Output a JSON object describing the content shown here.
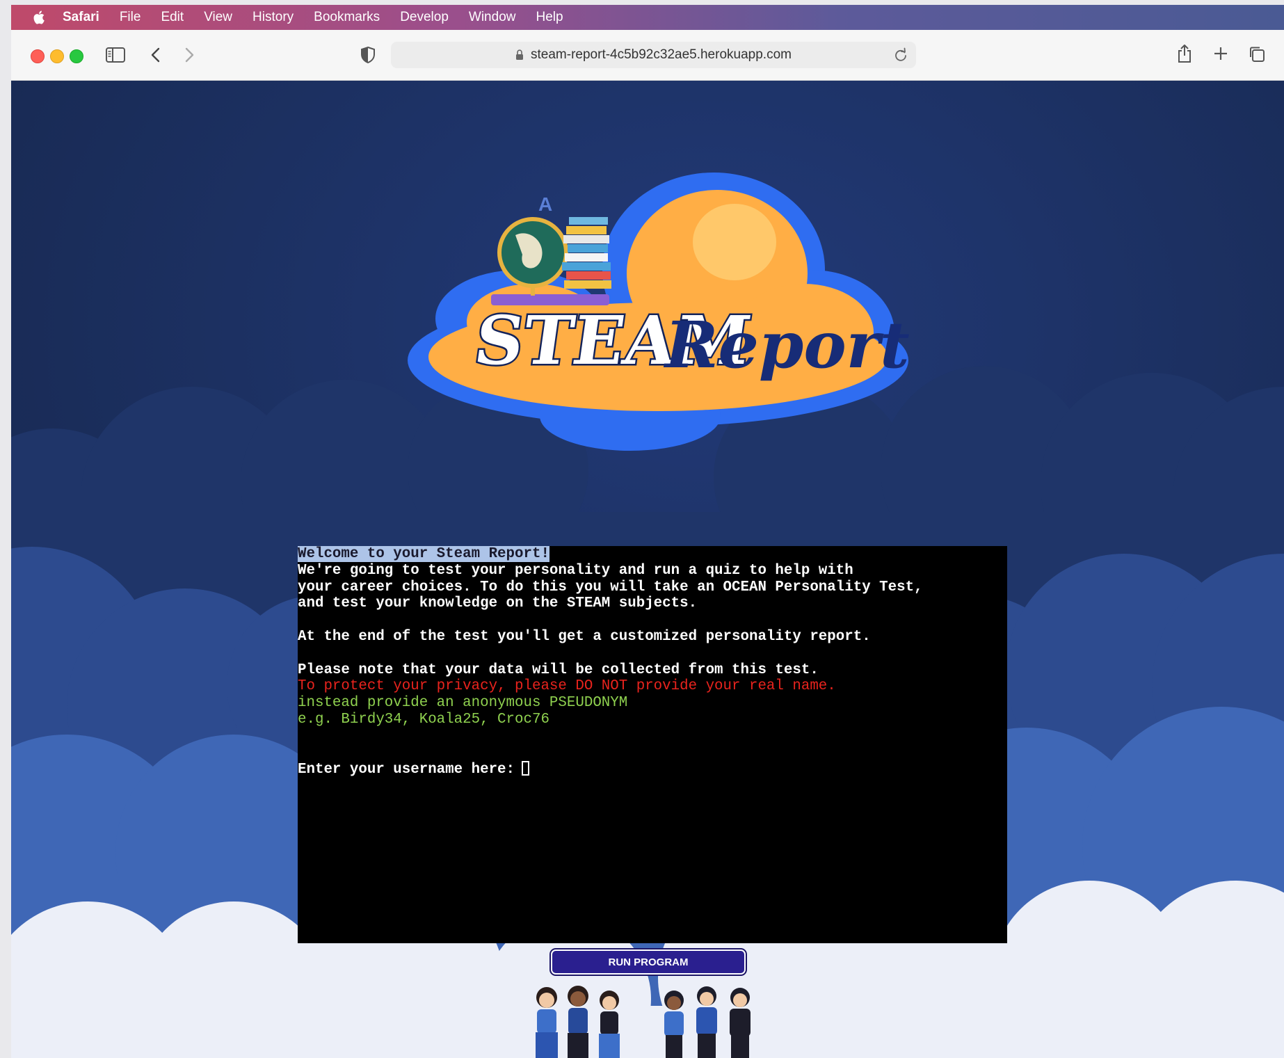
{
  "menubar": {
    "app_name": "Safari",
    "items": [
      "File",
      "Edit",
      "View",
      "History",
      "Bookmarks",
      "Develop",
      "Window",
      "Help"
    ]
  },
  "browser": {
    "url": "steam-report-4c5b92c32ae5.herokuapp.com"
  },
  "logo": {
    "word1": "STEAM",
    "word2": "Report"
  },
  "terminal": {
    "title_line": "Welcome to your Steam Report!",
    "intro_lines": [
      "We're going to test your personality and run a quiz to help with",
      "your career choices. To do this you will take an OCEAN Personality Test,",
      "and test your knowledge on the STEAM subjects."
    ],
    "end_line": "At the end of the test you'll get a customized personality report.",
    "data_note": "Please note that your data will be collected from this test.",
    "privacy_warning": "To protect your privacy, please DO NOT provide your real name.",
    "pseudonym_hint": "instead provide an anonymous PSEUDONYM",
    "examples": "e.g. Birdy34, Koala25, Croc76",
    "prompt": "Enter your username here:"
  },
  "run_button": {
    "label": "RUN PROGRAM"
  },
  "colors": {
    "page_bg": "#1d2d5d",
    "warning_red": "#e8231d",
    "hint_green": "#8fd14f",
    "button_bg": "#2a1f8f"
  }
}
